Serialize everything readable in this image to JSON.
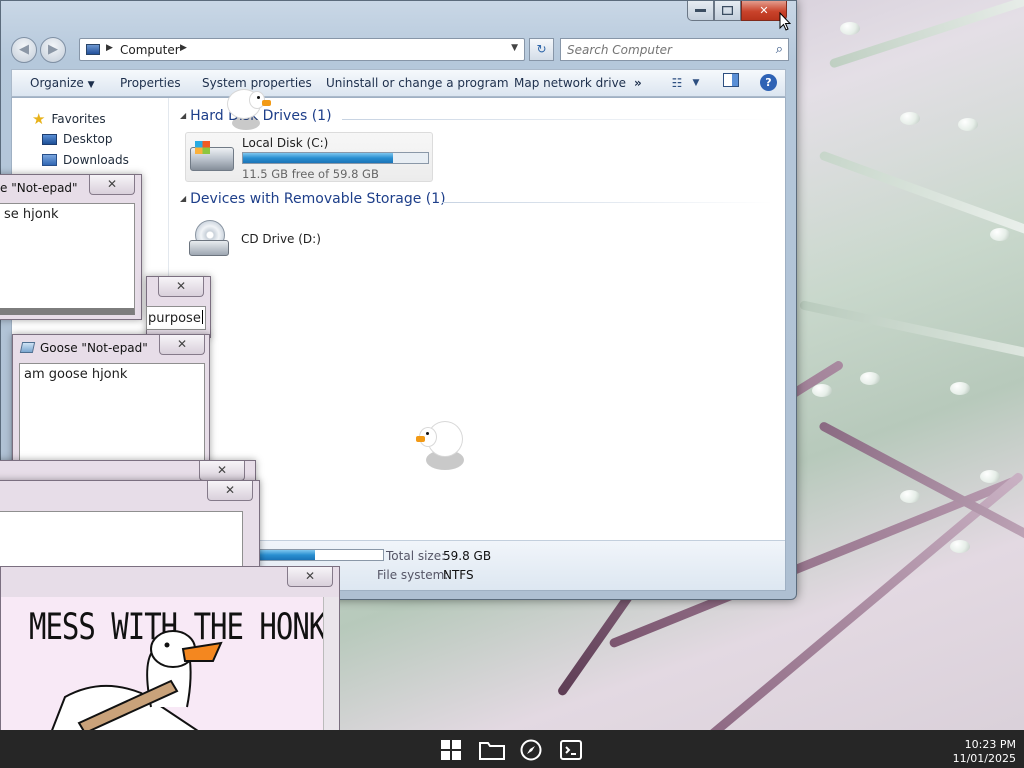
{
  "colors": {
    "accent": "#1e3f8a",
    "close_red": "#c9432b",
    "progress_blue": "#2a8fd1",
    "taskbar": "#262626"
  },
  "explorer": {
    "breadcrumb": "Computer",
    "search_placeholder": "Search Computer",
    "toolbar": {
      "organize": "Organize",
      "properties": "Properties",
      "system_properties": "System properties",
      "uninstall": "Uninstall or change a program",
      "map_drive": "Map network drive",
      "more": "»"
    },
    "nav": {
      "favorites": "Favorites",
      "desktop": "Desktop",
      "downloads": "Downloads"
    },
    "groups": {
      "hdd": "Hard Disk Drives (1)",
      "removable": "Devices with Removable Storage (1)"
    },
    "local_disk": {
      "name": "Local Disk (C:)",
      "free": "11.5 GB free of 59.8 GB",
      "used_fraction": 0.81
    },
    "cd_drive": {
      "name": "CD Drive (D:)"
    },
    "details": {
      "total_size_label": "Total size:",
      "total_size_value": "59.8 GB",
      "fs_label": "File system:",
      "fs_value": "NTFS",
      "used_fraction": 0.81
    }
  },
  "popups": {
    "notepad1": {
      "title": "e \"Not-epad\"",
      "text": "se hjonk"
    },
    "input_win": {
      "text": "purpose"
    },
    "notepad2": {
      "title": "Goose \"Not-epad\"",
      "text": "am goose hjonk"
    },
    "meme": {
      "caption": "MESS WITH THE HONK"
    },
    "close_glyph": "✕"
  },
  "taskbar": {
    "time": "10:23 PM",
    "date": "11/01/2025"
  }
}
